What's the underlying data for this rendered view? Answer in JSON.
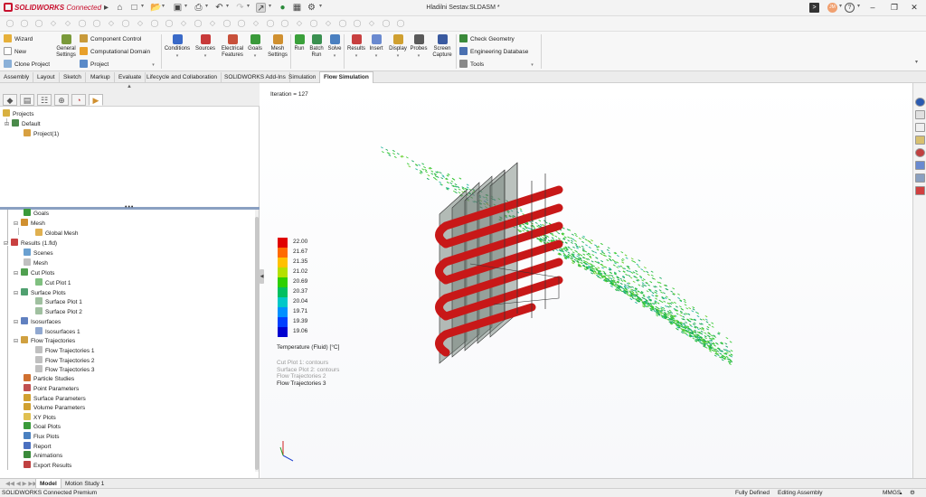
{
  "app": {
    "brand": "SOLIDWORKS",
    "brand_suffix": "Connected",
    "window_title": "Hladilni Sestav.SLDASM *",
    "user_initials": "JM"
  },
  "ribbon": {
    "wizard": "Wizard",
    "new": "New",
    "clone_project": "Clone Project",
    "general_settings": [
      "General",
      "Settings"
    ],
    "component_control": "Component Control",
    "computational_domain": "Computational Domain",
    "project": "Project",
    "conditions": "Conditions",
    "sources": "Sources",
    "electrical_features": [
      "Electrical",
      "Features"
    ],
    "goals": "Goals",
    "mesh_settings": [
      "Mesh",
      "Settings"
    ],
    "run": "Run",
    "batch_run": [
      "Batch",
      "Run"
    ],
    "solve": "Solve",
    "results": "Results",
    "insert": "Insert",
    "display": "Display",
    "probes": "Probes",
    "screen_capture": [
      "Screen",
      "Capture"
    ],
    "check_geometry": "Check Geometry",
    "engineering_database": "Engineering Database",
    "tools": "Tools"
  },
  "tabs": [
    "Assembly",
    "Layout",
    "Sketch",
    "Markup",
    "Evaluate",
    "Lifecycle and Collaboration",
    "SOLIDWORKS Add-Ins",
    "Simulation",
    "Flow Simulation"
  ],
  "active_tab": "Flow Simulation",
  "projects_tree": {
    "root": "Projects",
    "config": "Default",
    "project": "Project(1)"
  },
  "analysis_tree": {
    "goals": "Goals",
    "mesh": "Mesh",
    "global_mesh": "Global Mesh",
    "results": "Results (1.fld)",
    "scenes": "Scenes",
    "results_mesh": "Mesh",
    "cut_plots": "Cut Plots",
    "cut_plot_1": "Cut Plot 1",
    "surface_plots": "Surface Plots",
    "surface_plot_1": "Surface Plot 1",
    "surface_plot_2": "Surface Plot 2",
    "isosurfaces": "Isosurfaces",
    "isosurfaces_1": "Isosurfaces 1",
    "flow_trajectories": "Flow Trajectories",
    "flow_trajectories_1": "Flow Trajectories 1",
    "flow_trajectories_2": "Flow Trajectories 2",
    "flow_trajectories_3": "Flow Trajectories 3",
    "particle_studies": "Particle Studies",
    "point_parameters": "Point Parameters",
    "surface_parameters": "Surface Parameters",
    "volume_parameters": "Volume Parameters",
    "xy_plots": "XY Plots",
    "goal_plots": "Goal Plots",
    "flux_plots": "Flux Plots",
    "report": "Report",
    "animations": "Animations",
    "export_results": "Export Results"
  },
  "viewport": {
    "iteration": "Iteration = 127",
    "legend_values": [
      "22.00",
      "21.67",
      "21.35",
      "21.02",
      "20.69",
      "20.37",
      "20.04",
      "19.71",
      "19.39",
      "19.06"
    ],
    "legend_colors": [
      "#e00000",
      "#ff6a00",
      "#ffc000",
      "#b4e000",
      "#2ed000",
      "#00c060",
      "#00c8c8",
      "#0090ff",
      "#0040ff",
      "#0000d0"
    ],
    "legend_title": "Temperature (Fluid) [°C]",
    "captions": [
      "Cut Plot 1: contours",
      "Surface Plot 2: contours",
      "Flow Trajectories 2",
      "Flow Trajectories 3"
    ],
    "caption_colors": [
      "#999999",
      "#999999",
      "#999999",
      "#222222"
    ]
  },
  "bottom_tabs": [
    "Model",
    "Motion Study 1"
  ],
  "status": {
    "product": "SOLIDWORKS Connected Premium",
    "state": "Fully Defined",
    "mode": "Editing Assembly",
    "units": "MMGS"
  }
}
